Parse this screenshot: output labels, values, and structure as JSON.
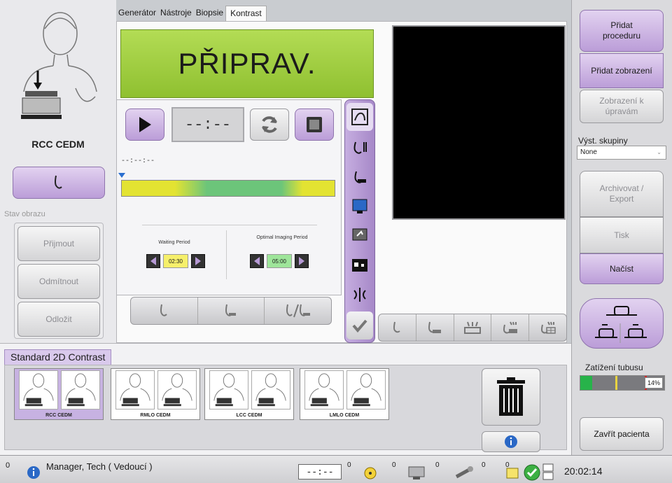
{
  "tabs": [
    {
      "label": "Generátor",
      "active": false
    },
    {
      "label": "Nástroje",
      "active": false
    },
    {
      "label": "Biopsie",
      "active": false
    },
    {
      "label": "Kontrast",
      "active": true
    }
  ],
  "view": {
    "label": "RCC CEDM"
  },
  "status_display": {
    "text": "PŘIPRAV."
  },
  "image_state": {
    "legend": "Stav obrazu",
    "buttons": [
      "Přijmout",
      "Odmítnout",
      "Odložit"
    ]
  },
  "timer": {
    "display": "--:--",
    "timeline_label": "--:--:--",
    "waiting": {
      "label": "Waiting Period",
      "value": "02:30"
    },
    "optimal": {
      "label": "Optimal Imaging Period",
      "value": "05:00"
    }
  },
  "procedure": {
    "title": "Standard 2D Contrast"
  },
  "thumbnails": [
    {
      "label": "RCC CEDM",
      "selected": true
    },
    {
      "label": "RMLO CEDM",
      "selected": false
    },
    {
      "label": "LCC CEDM",
      "selected": false
    },
    {
      "label": "LMLO CEDM",
      "selected": false
    }
  ],
  "right_panel": {
    "add_procedure": "Přidat proceduru",
    "add_view": "Přidat zobrazení",
    "edit_view": "Zobrazení k úpravám",
    "output_groups_label": "Výst. skupiny",
    "output_groups_value": "None",
    "archive": "Archivovat / Export",
    "print": "Tisk",
    "load": "Načíst",
    "tube_load_label": "Zatížení tubusu",
    "tube_load_value": "14%",
    "tube_load_fraction": 0.14,
    "close_patient": "Zavřít pacienta"
  },
  "status_bar": {
    "left_count": "0",
    "user": "Manager, Tech ( Vedoucí )",
    "timer": "--:--",
    "counts": [
      "0",
      "0",
      "0",
      "0",
      "0"
    ],
    "time": "20:02:14"
  },
  "colors": {
    "display_green": "#9ccc3c",
    "accent_purple": "#b79ad6",
    "header_purple": "#d9c9ec"
  }
}
